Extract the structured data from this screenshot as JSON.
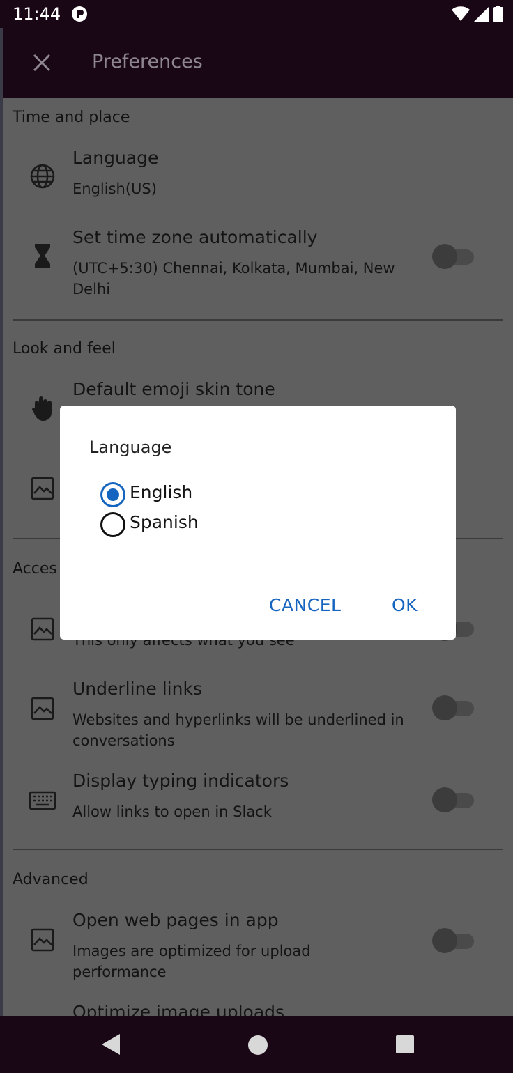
{
  "status_bar": {
    "time": "11:44"
  },
  "toolbar": {
    "title": "Preferences"
  },
  "sections": {
    "time_and_place": {
      "header": "Time and place",
      "language": {
        "title": "Language",
        "subtitle": "English(US)"
      },
      "timezone": {
        "title": "Set time zone automatically",
        "subtitle": "(UTC+5:30) Chennai, Kolkata, Mumbai, New Delhi"
      }
    },
    "look_and_feel": {
      "header": "Look and feel",
      "emoji": {
        "title": "Default emoji skin tone"
      }
    },
    "accessibility": {
      "header": "Acces",
      "partial_subtitle": "This only affects what you see",
      "underline": {
        "title": "Underline links",
        "subtitle": "Websites and hyperlinks will be underlined in conversations"
      },
      "typing": {
        "title": "Display typing indicators",
        "subtitle": "Allow links to open in Slack"
      }
    },
    "advanced": {
      "header": "Advanced",
      "web_pages": {
        "title": "Open web pages in app",
        "subtitle": "Images are optimized for upload performance"
      },
      "optimize": {
        "title": "Optimize image uploads"
      }
    }
  },
  "dialog": {
    "title": "Language",
    "options": [
      {
        "label": "English",
        "selected": true
      },
      {
        "label": "Spanish",
        "selected": false
      }
    ],
    "cancel_label": "CANCEL",
    "ok_label": "OK"
  },
  "colors": {
    "app_bar": "#1a0716",
    "scrim_background": "#5f5f5f",
    "accent": "#1565c0"
  }
}
